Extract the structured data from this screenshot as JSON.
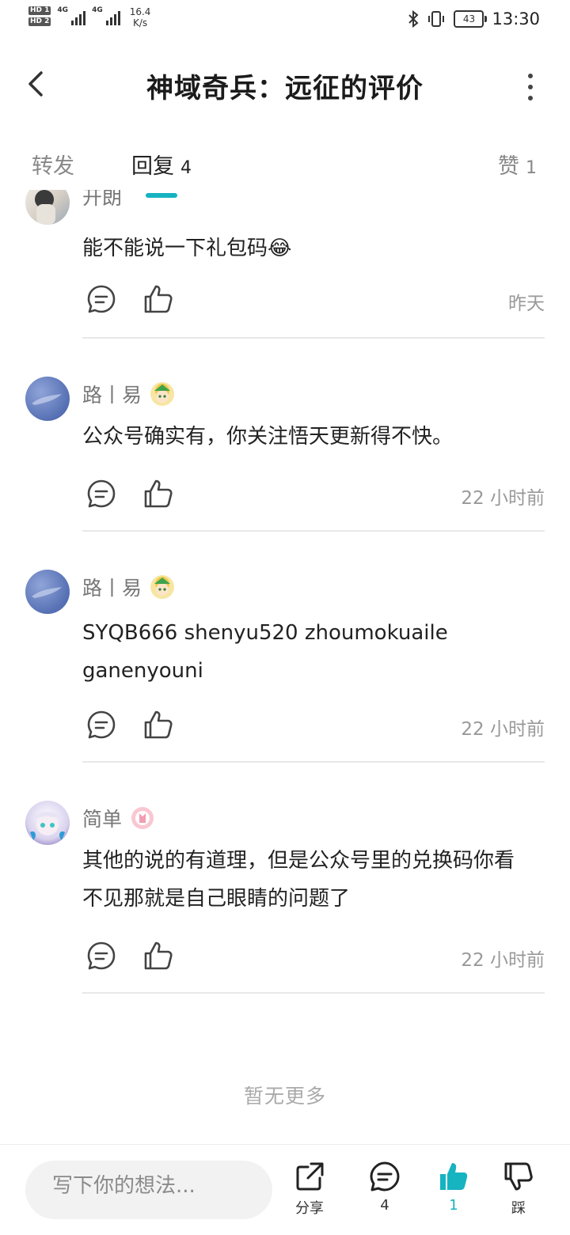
{
  "status_bar": {
    "hd1": "HD 1",
    "hd2": "HD 2",
    "net1": "4G",
    "net2": "4G",
    "speed_value": "16.4",
    "speed_unit": "K/s",
    "battery": "43",
    "time": "13:30"
  },
  "header": {
    "title": "神域奇兵：远征的评价"
  },
  "tabs": [
    {
      "label": "转发",
      "count": ""
    },
    {
      "label": "回复",
      "count": "4"
    },
    {
      "label": "赞",
      "count": "1"
    }
  ],
  "comments": [
    {
      "username": "开朗",
      "text": "能不能说一下礼包码😂",
      "time": "昨天"
    },
    {
      "username": "路丨易",
      "text": "公众号确实有，你关注悟天更新得不快。",
      "time": "22 小时前"
    },
    {
      "username": "路丨易",
      "text": "SYQB666 shenyu520 zhoumokuaile ganenyouni",
      "time": "22 小时前"
    },
    {
      "username": "简单",
      "text": "其他的说的有道理，但是公众号里的兑换码你看不见那就是自己眼睛的问题了",
      "time": "22 小时前"
    }
  ],
  "footer": {
    "no_more": "暂无更多"
  },
  "bottom_bar": {
    "input_placeholder": "写下你的想法...",
    "share_label": "分享",
    "comment_count": "4",
    "like_count": "1",
    "dislike_label": "踩"
  },
  "colors": {
    "accent": "#16b3c1",
    "text_primary": "#222222",
    "text_secondary": "#999999"
  },
  "icons": {
    "back": "back-arrow-icon",
    "more": "more-vertical-icon",
    "reply": "comment-bubble-icon",
    "like": "thumbs-up-icon",
    "share": "share-icon",
    "dislike": "thumbs-down-icon"
  }
}
